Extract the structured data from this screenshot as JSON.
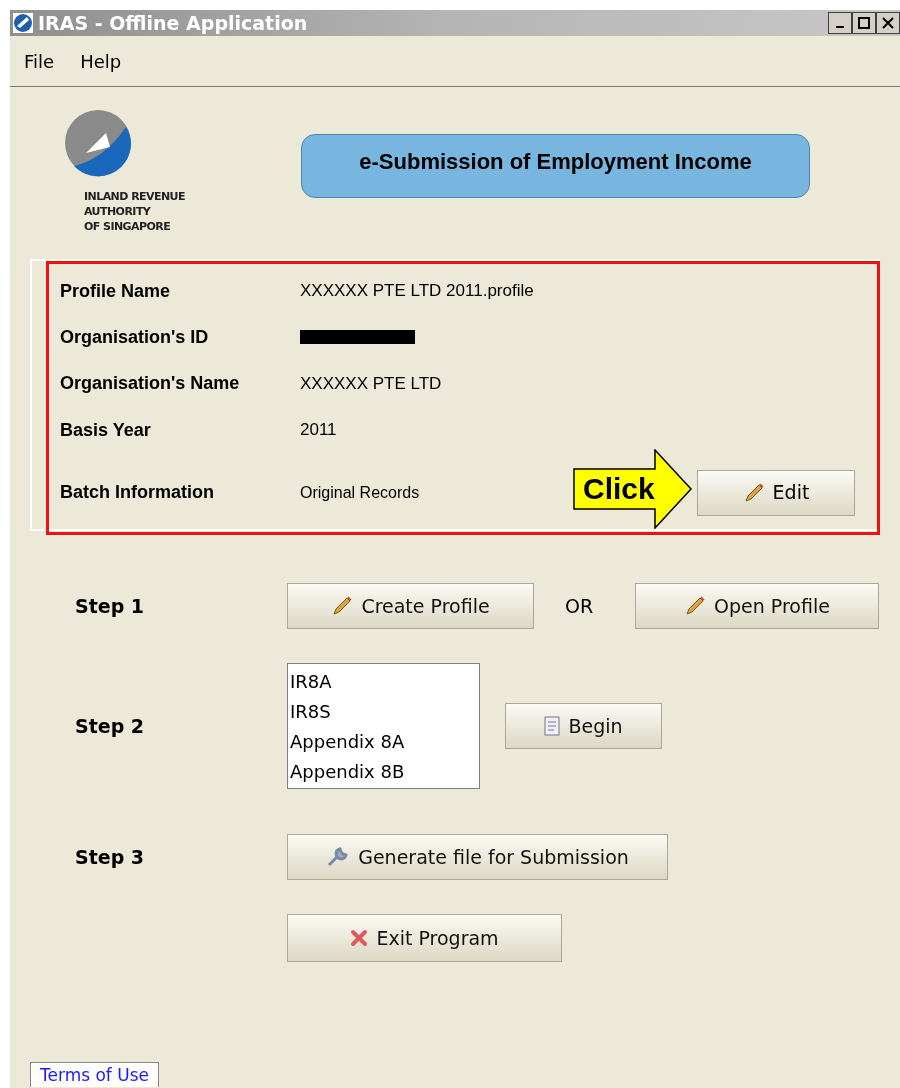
{
  "window": {
    "title": "IRAS - Offline Application"
  },
  "menu": [
    "File",
    "Help"
  ],
  "logo": {
    "lines": [
      "INLAND REVENUE",
      "AUTHORITY",
      "OF SINGAPORE"
    ]
  },
  "banner": {
    "title": "e-Submission of Employment Income"
  },
  "profile": {
    "fields": [
      {
        "label": "Profile Name",
        "kind": "text",
        "value": "XXXXXX PTE LTD 2011.profile"
      },
      {
        "label": "Organisation's ID",
        "kind": "redacted"
      },
      {
        "label": "Organisation's Name",
        "kind": "text",
        "value": "XXXXXX PTE LTD"
      },
      {
        "label": "Basis Year",
        "kind": "text",
        "value": "2011"
      },
      {
        "label": "Batch Information",
        "kind": "text",
        "value": "Original Records"
      }
    ],
    "edit_button": "Edit",
    "callout": "Click"
  },
  "step1": {
    "label": "Step 1",
    "create_button": "Create Profile",
    "separator": "OR",
    "open_button": "Open Profile"
  },
  "step2": {
    "label": "Step 2",
    "list_items": [
      "IR8A",
      "IR8S",
      "Appendix 8A",
      "Appendix 8B"
    ],
    "begin_button": "Begin"
  },
  "step3": {
    "label": "Step 3",
    "generate_button": "Generate file for Submission"
  },
  "exit_button": "Exit Program",
  "terms_link": "Terms of Use"
}
